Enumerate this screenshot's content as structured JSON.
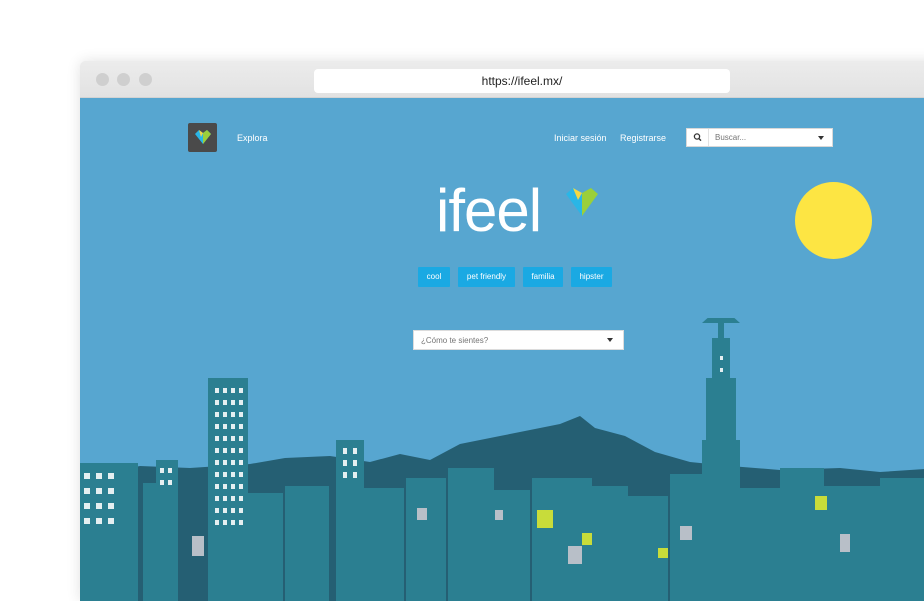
{
  "browser": {
    "url": "https://ifeel.mx/"
  },
  "nav": {
    "explore_label": "Explora",
    "login_label": "Iniciar sesión",
    "register_label": "Registrarse"
  },
  "search": {
    "placeholder": "Buscar..."
  },
  "hero": {
    "wordmark": "ifeel",
    "tags": [
      "cool",
      "pet friendly",
      "familia",
      "hipster"
    ],
    "feel_placeholder": "¿Cómo te sientes?"
  },
  "colors": {
    "sky": "#57a6d0",
    "tag": "#1aa9e3",
    "sun": "#fde543",
    "buildings": "#2b7f91",
    "mountains": "#255f73"
  }
}
